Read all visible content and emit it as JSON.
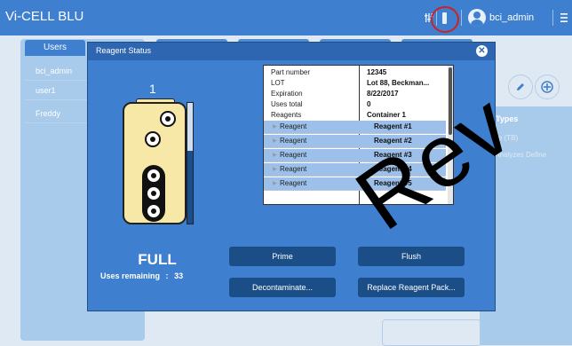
{
  "app": {
    "title": "Vi-CELL BLU"
  },
  "topbar": {
    "username": "bci_admin",
    "icons": [
      "settings-sliders-icon",
      "reagent-pack-icon",
      "user-avatar-icon",
      "hamburger-menu-icon"
    ]
  },
  "background": {
    "nav_header": "Users",
    "users": [
      "bci_admin",
      "user1",
      "Freddy"
    ],
    "types_header": "Types",
    "types_lines": [
      "letrie (TB)",
      "Cl Analyzes Define"
    ]
  },
  "modal": {
    "title": "Reagent Status",
    "pack_number": "1",
    "status": "FULL",
    "uses_remaining_label": "Uses remaining",
    "uses_remaining_separator": ":",
    "uses_remaining_value": "33",
    "level_fraction": 0.6,
    "info": {
      "rows": [
        {
          "label": "Part number",
          "value": "12345"
        },
        {
          "label": "LOT",
          "value": "Lot 88, Beckman..."
        },
        {
          "label": "Expiration",
          "value": "8/22/2017"
        },
        {
          "label": "Uses total",
          "value": "0"
        },
        {
          "label": "Reagents",
          "value": "Container 1"
        }
      ],
      "reagents": [
        {
          "label": "Reagent",
          "value": "Reagent #1"
        },
        {
          "label": "Reagent",
          "value": "Reagent #2"
        },
        {
          "label": "Reagent",
          "value": "Reagent #3"
        },
        {
          "label": "Reagent",
          "value": "Reagent #4"
        },
        {
          "label": "Reagent",
          "value": "Reagent #5"
        }
      ]
    },
    "buttons": {
      "prime": "Prime",
      "flush": "Flush",
      "decontaminate": "Decontaminate...",
      "replace": "Replace Reagent Pack..."
    }
  },
  "watermark": "Rev",
  "colors": {
    "accent": "#3e7fcf",
    "button": "#1b4e86",
    "highlight": "#cc2222"
  }
}
